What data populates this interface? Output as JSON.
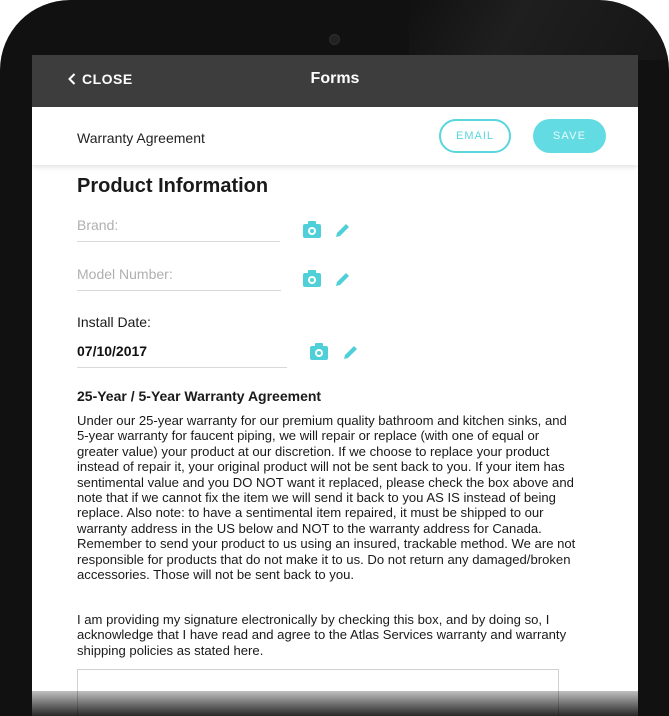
{
  "navbar": {
    "close_label": "CLOSE",
    "title": "Forms"
  },
  "toolbar": {
    "form_name": "Warranty Agreement",
    "email_label": "EMAIL",
    "save_label": "SAVE"
  },
  "product_info": {
    "section_title": "Product Information",
    "brand_placeholder": "Brand:",
    "model_placeholder": "Model Number:",
    "install_date_label": "Install Date:",
    "install_date_value": "07/10/2017"
  },
  "agreement": {
    "title": "25-Year / 5-Year Warranty Agreement",
    "body": "Under our 25-year warranty for our premium quality bathroom and kitchen sinks, and 5-year warranty for faucent piping, we will repair or replace (with one of equal or greater value) your product at our discretion. If we choose to replace your product instead of repair it, your original product will not be sent back to you. If your item has sentimental value and you DO NOT want it replaced, please check the box above and note that if we cannot fix the item we will send it back to you AS IS instead of being replace. Also note: to have a sentimental item repaired, it must be shipped to our warranty address in the US below and NOT to the warranty address for Canada. Remember to send your product to us using an insured, trackable method. We are not responsible for products that do not make it to us. Do not return any damaged/broken accessories. Those will not be sent back to you.",
    "consent": "I am providing my signature electronically by checking this box, and by doing so, I acknowledge that I have read and agree to the Atlas Services warranty and warranty shipping policies as stated here."
  },
  "icons": {
    "back": "chevron-left-icon",
    "camera": "camera-icon",
    "edit": "pencil-icon"
  },
  "colors": {
    "accent": "#5ad6dd",
    "navbar": "#3d3d3d"
  }
}
